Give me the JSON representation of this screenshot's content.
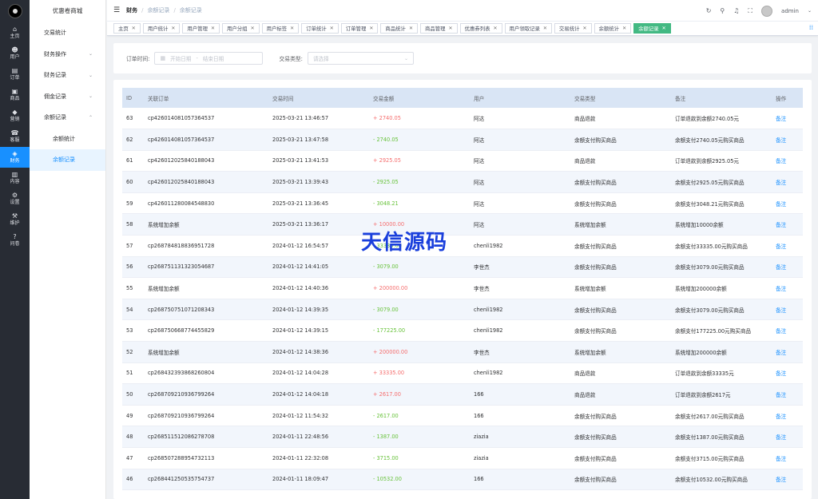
{
  "rail": {
    "items": [
      {
        "icon": "⌂",
        "label": "主页"
      },
      {
        "icon": "☻",
        "label": "用户"
      },
      {
        "icon": "▤",
        "label": "订单"
      },
      {
        "icon": "▣",
        "label": "商品"
      },
      {
        "icon": "◆",
        "label": "营销"
      },
      {
        "icon": "☎",
        "label": "客服"
      },
      {
        "icon": "◈",
        "label": "财务"
      },
      {
        "icon": "▥",
        "label": "内容"
      },
      {
        "icon": "⚙",
        "label": "设置"
      },
      {
        "icon": "⚒",
        "label": "维护"
      },
      {
        "icon": "?",
        "label": "问卷"
      }
    ]
  },
  "submenu": {
    "title": "优惠卷商城",
    "items": [
      {
        "label": "交易统计",
        "arrow": ""
      },
      {
        "label": "财务操作",
        "arrow": "⌄"
      },
      {
        "label": "财务记录",
        "arrow": "⌄"
      },
      {
        "label": "佣金记录",
        "arrow": "⌄"
      },
      {
        "label": "余额记录",
        "arrow": "⌃"
      }
    ],
    "children": [
      {
        "label": "余额统计"
      },
      {
        "label": "余额记录"
      }
    ]
  },
  "header": {
    "breadcrumb": [
      "财务",
      "余额记录",
      "余额记录"
    ],
    "user": "admin"
  },
  "tags": [
    "主页",
    "用户统计",
    "用户管理",
    "用户分组",
    "用户标签",
    "订单统计",
    "订单管理",
    "商品统计",
    "商品管理",
    "优惠券列表",
    "用户领取记录",
    "交易统计",
    "余额统计",
    "余额记录"
  ],
  "filter": {
    "order_time_label": "订单时间:",
    "start_placeholder": "开始日期",
    "range_sep": "-",
    "end_placeholder": "结束日期",
    "type_label": "交易类型:",
    "type_placeholder": "请选择"
  },
  "table": {
    "columns": [
      "ID",
      "关联订单",
      "交易时间",
      "交易金额",
      "用户",
      "交易类型",
      "备注",
      "操作"
    ],
    "rows": [
      {
        "id": "63",
        "order": "cp426014081057364537",
        "time": "2025-03-21 13:46:57",
        "amount": "+ 2740.05",
        "sign": "pos",
        "user": "阿达",
        "type": "商品退款",
        "note": "订单退款到余额2740.05元",
        "op": "备注"
      },
      {
        "id": "62",
        "order": "cp426014081057364537",
        "time": "2025-03-21 13:47:58",
        "amount": "- 2740.05",
        "sign": "neg",
        "user": "阿达",
        "type": "余额支付购买商品",
        "note": "余额支付2740.05元购买商品",
        "op": "备注"
      },
      {
        "id": "61",
        "order": "cp426012025840188043",
        "time": "2025-03-21 13:41:53",
        "amount": "+ 2925.05",
        "sign": "pos",
        "user": "阿达",
        "type": "商品退款",
        "note": "订单退款到余额2925.05元",
        "op": "备注"
      },
      {
        "id": "60",
        "order": "cp426012025840188043",
        "time": "2025-03-21 13:39:43",
        "amount": "- 2925.05",
        "sign": "neg",
        "user": "阿达",
        "type": "余额支付购买商品",
        "note": "余额支付2925.05元购买商品",
        "op": "备注"
      },
      {
        "id": "59",
        "order": "cp426011280084548830",
        "time": "2025-03-21 13:36:45",
        "amount": "- 3048.21",
        "sign": "neg",
        "user": "阿达",
        "type": "余额支付购买商品",
        "note": "余额支付3048.21元购买商品",
        "op": "备注"
      },
      {
        "id": "58",
        "order": "系统增加余额",
        "time": "2025-03-21 13:36:17",
        "amount": "+ 10000.00",
        "sign": "pos",
        "user": "阿达",
        "type": "系统增加余额",
        "note": "系统增加10000余额",
        "op": "备注"
      },
      {
        "id": "57",
        "order": "cp268784818836951728",
        "time": "2024-01-12 16:54:57",
        "amount": "- 33335.00",
        "sign": "neg",
        "user": "chenli1982",
        "type": "余额支付购买商品",
        "note": "余额支付33335.00元购买商品",
        "op": "备注"
      },
      {
        "id": "56",
        "order": "cp268751131323054687",
        "time": "2024-01-12 14:41:05",
        "amount": "- 3079.00",
        "sign": "neg",
        "user": "李世杰",
        "type": "余额支付购买商品",
        "note": "余额支付3079.00元购买商品",
        "op": "备注"
      },
      {
        "id": "55",
        "order": "系统增加余额",
        "time": "2024-01-12 14:40:36",
        "amount": "+ 200000.00",
        "sign": "pos",
        "user": "李世杰",
        "type": "系统增加余额",
        "note": "系统增加200000余额",
        "op": "备注"
      },
      {
        "id": "54",
        "order": "cp268750751071208343",
        "time": "2024-01-12 14:39:35",
        "amount": "- 3079.00",
        "sign": "neg",
        "user": "chenli1982",
        "type": "余额支付购买商品",
        "note": "余额支付3079.00元购买商品",
        "op": "备注"
      },
      {
        "id": "53",
        "order": "cp268750668774455829",
        "time": "2024-01-12 14:39:15",
        "amount": "- 177225.00",
        "sign": "neg",
        "user": "chenli1982",
        "type": "余额支付购买商品",
        "note": "余额支付177225.00元购买商品",
        "op": "备注"
      },
      {
        "id": "52",
        "order": "系统增加余额",
        "time": "2024-01-12 14:38:36",
        "amount": "+ 200000.00",
        "sign": "pos",
        "user": "李世杰",
        "type": "系统增加余额",
        "note": "系统增加200000余额",
        "op": "备注"
      },
      {
        "id": "51",
        "order": "cp268432393868260804",
        "time": "2024-01-12 14:04:28",
        "amount": "+ 33335.00",
        "sign": "pos",
        "user": "chenli1982",
        "type": "商品退款",
        "note": "订单退款到余额33335元",
        "op": "备注"
      },
      {
        "id": "50",
        "order": "cp268709210936799264",
        "time": "2024-01-12 14:04:18",
        "amount": "+ 2617.00",
        "sign": "pos",
        "user": "166",
        "type": "商品退款",
        "note": "订单退款到余额2617元",
        "op": "备注"
      },
      {
        "id": "49",
        "order": "cp268709210936799264",
        "time": "2024-01-12 11:54:32",
        "amount": "- 2617.00",
        "sign": "neg",
        "user": "166",
        "type": "余额支付购买商品",
        "note": "余额支付2617.00元购买商品",
        "op": "备注"
      },
      {
        "id": "48",
        "order": "cp268511512086278708",
        "time": "2024-01-11 22:48:56",
        "amount": "- 1387.00",
        "sign": "neg",
        "user": "ziazia",
        "type": "余额支付购买商品",
        "note": "余额支付1387.00元购买商品",
        "op": "备注"
      },
      {
        "id": "47",
        "order": "cp268507288954732113",
        "time": "2024-01-11 22:32:08",
        "amount": "- 3715.00",
        "sign": "neg",
        "user": "ziazia",
        "type": "余额支付购买商品",
        "note": "余额支付3715.00元购买商品",
        "op": "备注"
      },
      {
        "id": "46",
        "order": "cp268441250535754737",
        "time": "2024-01-11 18:09:47",
        "amount": "- 10532.00",
        "sign": "neg",
        "user": "166",
        "type": "余额支付购买商品",
        "note": "余额支付10532.00元购买商品",
        "op": "备注"
      }
    ]
  },
  "watermark": "天信源码",
  "colors": {
    "rail_bg": "#282c34",
    "accent": "#1890ff",
    "tag_active": "#42b983",
    "positive": "#f56c6c",
    "negative": "#67c23a"
  }
}
